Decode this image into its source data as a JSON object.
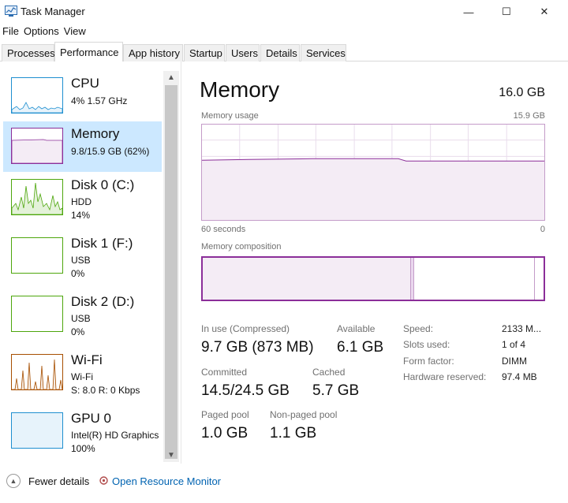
{
  "window": {
    "title": "Task Manager",
    "minimize": "—",
    "maximize": "☐",
    "close": "✕"
  },
  "menu": [
    "File",
    "Options",
    "View"
  ],
  "tabs": [
    "Processes",
    "Performance",
    "App history",
    "Startup",
    "Users",
    "Details",
    "Services"
  ],
  "sidebar": {
    "items": [
      {
        "name": "CPU",
        "lines": [
          "4% 1.57 GHz"
        ]
      },
      {
        "name": "Memory",
        "lines": [
          "9.8/15.9 GB (62%)"
        ]
      },
      {
        "name": "Disk 0 (C:)",
        "lines": [
          "HDD",
          "14%"
        ]
      },
      {
        "name": "Disk 1 (F:)",
        "lines": [
          "USB",
          "0%"
        ]
      },
      {
        "name": "Disk 2 (D:)",
        "lines": [
          "USB",
          "0%"
        ]
      },
      {
        "name": "Wi-Fi",
        "lines": [
          "Wi-Fi",
          "S: 8.0  R: 0 Kbps"
        ]
      },
      {
        "name": "GPU 0",
        "lines": [
          "Intel(R) HD Graphics",
          "100%"
        ]
      }
    ]
  },
  "memory": {
    "title": "Memory",
    "total": "16.0 GB",
    "usage_label": "Memory usage",
    "usage_max": "15.9 GB",
    "time_left": "60 seconds",
    "time_right": "0",
    "composition_label": "Memory composition",
    "in_use_fraction": 0.61,
    "modified_fraction": 0.01,
    "standby_fraction": 0.355,
    "stats": {
      "in_use_label": "In use (Compressed)",
      "in_use_value": "9.7 GB (873 MB)",
      "available_label": "Available",
      "available_value": "6.1 GB",
      "committed_label": "Committed",
      "committed_value": "14.5/24.5 GB",
      "cached_label": "Cached",
      "cached_value": "5.7 GB",
      "paged_label": "Paged pool",
      "paged_value": "1.0 GB",
      "nonpaged_label": "Non-paged pool",
      "nonpaged_value": "1.1 GB"
    },
    "specs": {
      "speed_label": "Speed:",
      "speed_value": "2133 M...",
      "slots_label": "Slots used:",
      "slots_value": "1 of 4",
      "form_label": "Form factor:",
      "form_value": "DIMM",
      "reserved_label": "Hardware reserved:",
      "reserved_value": "97.4 MB"
    }
  },
  "footer": {
    "fewer": "Fewer details",
    "monitor": "Open Resource Monitor"
  },
  "colors": {
    "memory": "#8b2e99",
    "cpu": "#1f8fd0",
    "disk": "#4da60c",
    "wifi": "#a74f01",
    "gpu": "#1f8fd0",
    "selected": "#cce8ff"
  }
}
